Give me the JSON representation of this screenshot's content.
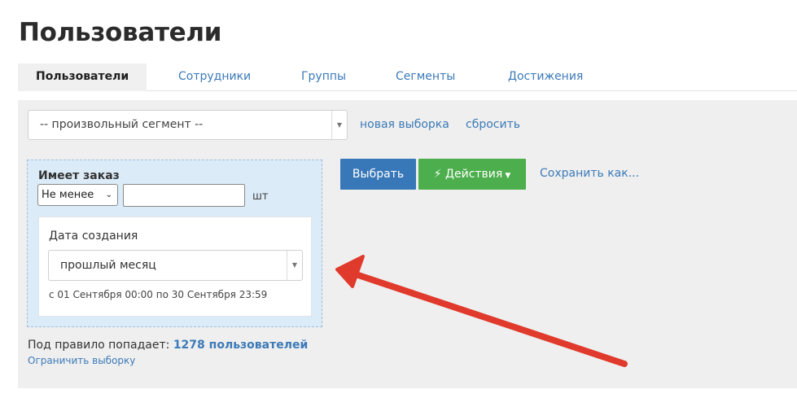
{
  "header": {
    "title": "Пользователи"
  },
  "tabs": [
    {
      "label": "Пользователи",
      "active": true
    },
    {
      "label": "Сотрудники",
      "active": false
    },
    {
      "label": "Группы",
      "active": false
    },
    {
      "label": "Сегменты",
      "active": false
    },
    {
      "label": "Достижения",
      "active": false
    }
  ],
  "filter": {
    "segment_select": "-- произвольный сегмент --",
    "new_selection_link": "новая выборка",
    "reset_link": "сбросить"
  },
  "rule": {
    "title": "Имеет заказ",
    "condition_select": "Не менее",
    "quantity_value": "",
    "unit": "шт",
    "date_label": "Дата создания",
    "period_select": "прошлый месяц",
    "range_text": "с 01 Сентября 00:00 по 30 Сентября 23:59"
  },
  "actions": {
    "select_button": "Выбрать",
    "actions_button": "Действия",
    "save_as_link": "Сохранить как..."
  },
  "result": {
    "prefix": "Под правило попадает:",
    "count": "1278 пользователей",
    "limit_link": "Ограничить выборку"
  },
  "colors": {
    "accent_blue": "#3978b8",
    "accent_green": "#4cae4c",
    "annotation_red": "#e03a2c"
  },
  "icons": {
    "actions_icon": "lightning-icon"
  }
}
